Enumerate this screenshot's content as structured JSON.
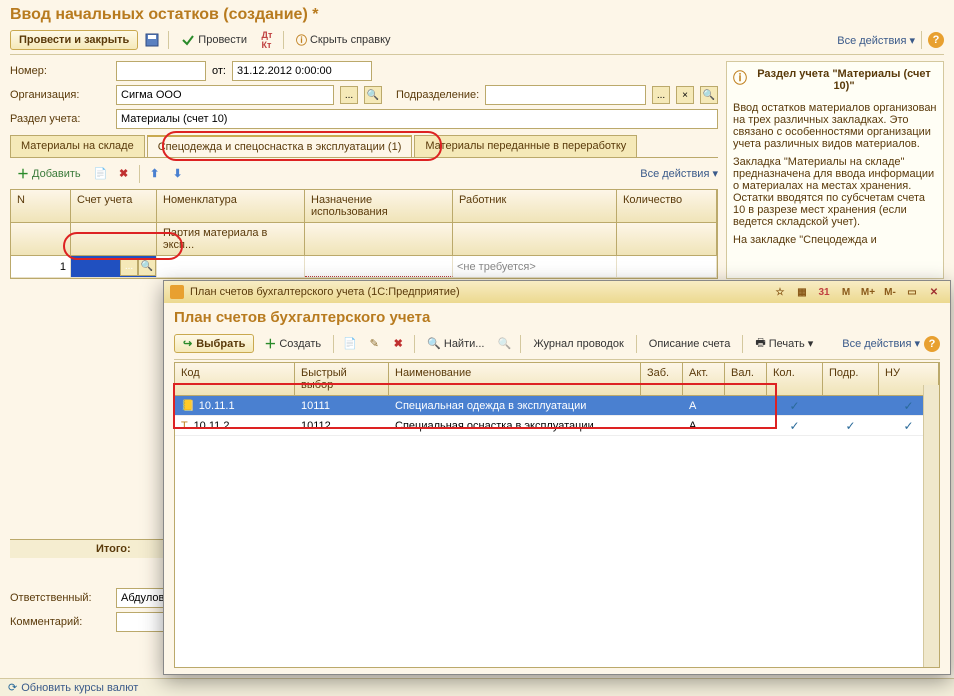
{
  "header": {
    "title": "Ввод начальных остатков (создание) *",
    "btn_main": "Провести и закрыть",
    "btn_post": "Провести",
    "btn_hide_help": "Скрыть справку",
    "all_actions": "Все действия"
  },
  "form": {
    "number_label": "Номер:",
    "number_value": "",
    "from_label": "от:",
    "date_value": "31.12.2012 0:00:00",
    "org_label": "Организация:",
    "org_value": "Сигма ООО",
    "dept_label": "Подразделение:",
    "dept_value": "",
    "section_label": "Раздел учета:",
    "section_value": "Материалы (счет 10)"
  },
  "tabs": {
    "t1": "Материалы на складе",
    "t2": "Спецодежда и спецоснастка в эксплуатации (1)",
    "t3": "Материалы переданные в переработку"
  },
  "grid_toolbar": {
    "add": "Добавить",
    "all_actions": "Все действия"
  },
  "grid_headers": {
    "n": "N",
    "acc": "Счет учета",
    "nom": "Номенклатура",
    "purpose": "Назначение использования",
    "worker": "Работник",
    "qty": "Количество",
    "batch": "Партия материала в эксп..."
  },
  "grid_row": {
    "n": "1",
    "worker": "<не требуется>"
  },
  "totals": {
    "label": "Итого:"
  },
  "footer": {
    "resp_label": "Ответственный:",
    "resp_value": "Абдулов",
    "comment_label": "Комментарий:",
    "comment_value": ""
  },
  "statusbar": {
    "update": "Обновить курсы валют"
  },
  "help": {
    "title": "Раздел учета \"Материалы (счет 10)\"",
    "p1": "Ввод остатков материалов организован на трех различных закладках. Это связано с особенностями организации учета различных видов материалов.",
    "p2": "Закладка \"Материалы на складе\" предназначена для ввода информации о материалах на местах хранения. Остатки вводятся по субсчетам счета 10 в разрезе мест хранения (если ведется складской учет).",
    "p3": "На закладке \"Спецодежда и"
  },
  "modal": {
    "win_title": "План счетов бухгалтерского учета  (1С:Предприятие)",
    "title": "План счетов бухгалтерского учета",
    "m_btns": {
      "m": "M",
      "mp": "M+",
      "mm": "M-"
    },
    "tb": {
      "select": "Выбрать",
      "create": "Создать",
      "find": "Найти...",
      "journal": "Журнал проводок",
      "desc": "Описание счета",
      "print": "Печать",
      "all_actions": "Все действия"
    },
    "cols": {
      "code": "Код",
      "quick": "Быстрый выбор",
      "name": "Наименование",
      "zab": "Заб.",
      "act": "Акт.",
      "val": "Вал.",
      "qty": "Кол.",
      "sub": "Подр.",
      "nu": "НУ"
    },
    "rows": [
      {
        "code": "10.11.1",
        "quick": "10111",
        "name": "Специальная одежда в эксплуатации",
        "act": "А",
        "qty": "✓",
        "sub": "",
        "nu": "✓"
      },
      {
        "code": "10.11.2",
        "quick": "10112",
        "name": "Специальная оснастка в эксплуатации",
        "act": "А",
        "qty": "✓",
        "sub": "✓",
        "nu": "✓"
      }
    ]
  }
}
